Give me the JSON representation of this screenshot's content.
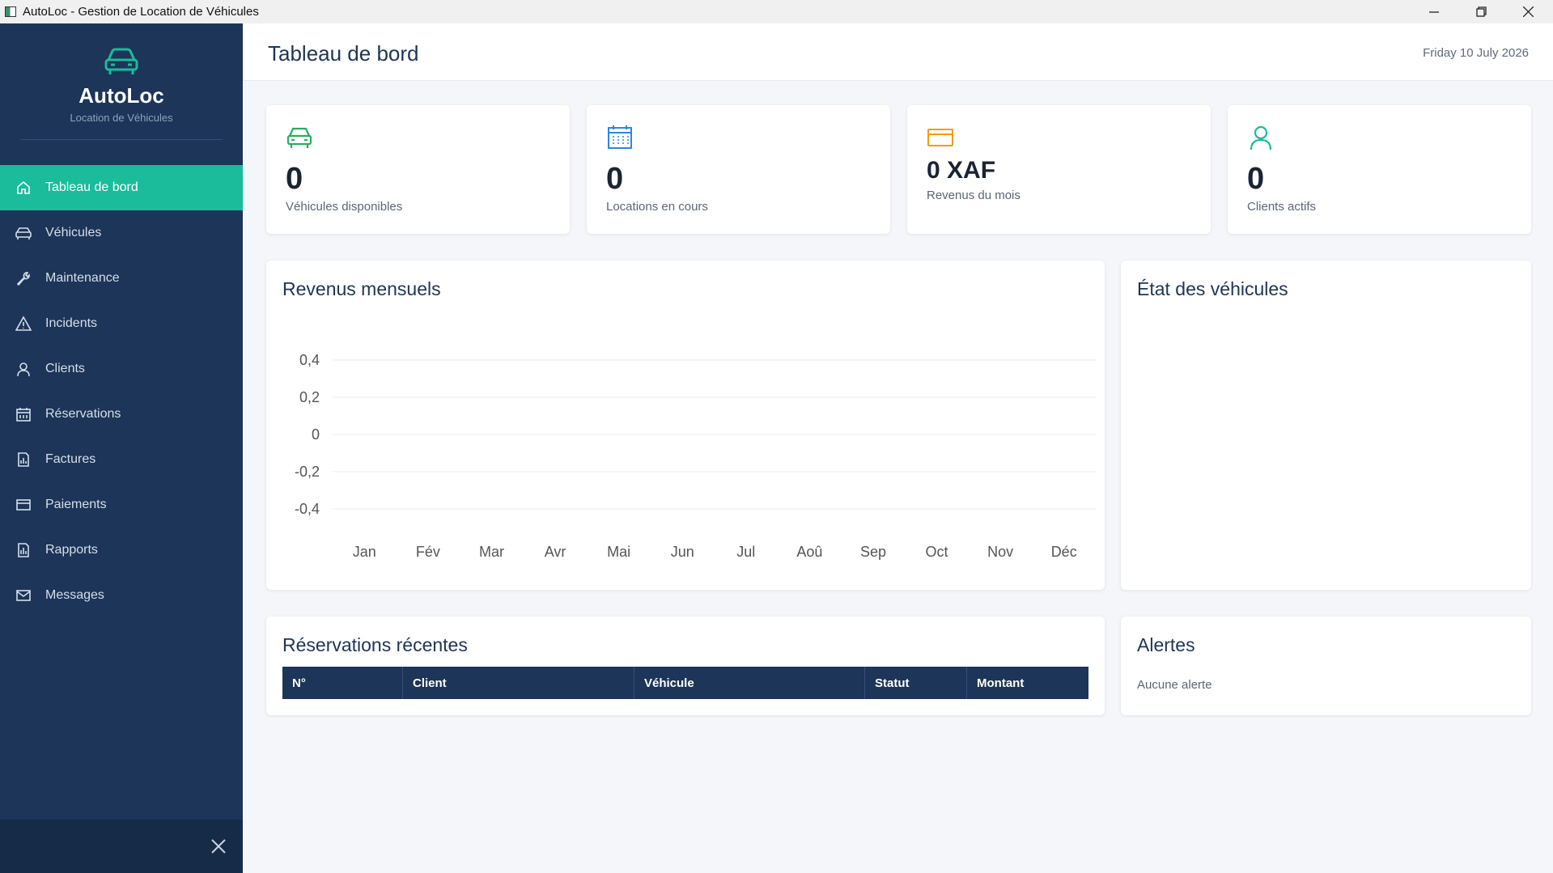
{
  "window": {
    "title": "AutoLoc - Gestion de Location de Véhicules"
  },
  "sidebar": {
    "brand_name": "AutoLoc",
    "brand_sub": "Location de Véhicules",
    "items": [
      {
        "label": "Tableau de bord",
        "icon": "home-icon",
        "active": true
      },
      {
        "label": "Véhicules",
        "icon": "car-icon",
        "active": false
      },
      {
        "label": "Maintenance",
        "icon": "wrench-icon",
        "active": false
      },
      {
        "label": "Incidents",
        "icon": "warning-icon",
        "active": false
      },
      {
        "label": "Clients",
        "icon": "user-icon",
        "active": false
      },
      {
        "label": "Réservations",
        "icon": "calendar-icon",
        "active": false
      },
      {
        "label": "Factures",
        "icon": "invoice-icon",
        "active": false
      },
      {
        "label": "Paiements",
        "icon": "card-icon",
        "active": false
      },
      {
        "label": "Rapports",
        "icon": "report-icon",
        "active": false
      },
      {
        "label": "Messages",
        "icon": "mail-icon",
        "active": false
      }
    ]
  },
  "header": {
    "title": "Tableau de bord",
    "date": "Friday 10 July 2026"
  },
  "stats": [
    {
      "value": "0",
      "label": "Véhicules disponibles",
      "icon": "car-icon",
      "color": "#27ae60"
    },
    {
      "value": "0",
      "label": "Locations en cours",
      "icon": "calendar-icon",
      "color": "#2e86de"
    },
    {
      "value": "0 XAF",
      "label": "Revenus du mois",
      "icon": "card-icon",
      "color": "#f39c12"
    },
    {
      "value": "0",
      "label": "Clients actifs",
      "icon": "user-icon",
      "color": "#1abc9c"
    }
  ],
  "revenue_panel": {
    "title": "Revenus mensuels"
  },
  "chart_data": {
    "type": "line",
    "categories": [
      "Jan",
      "Fév",
      "Mar",
      "Avr",
      "Mai",
      "Jun",
      "Jul",
      "Aoû",
      "Sep",
      "Oct",
      "Nov",
      "Déc"
    ],
    "series": [
      {
        "values": [
          0,
          0,
          0,
          0,
          0,
          0,
          0,
          0,
          0,
          0,
          0,
          0
        ]
      }
    ],
    "yticks": [
      "0,4",
      "0,2",
      "0",
      "-0,2",
      "-0,4"
    ],
    "ylim": [
      -0.4,
      0.4
    ],
    "grid": true,
    "legend": "none"
  },
  "vehicles_panel": {
    "title": "État des véhicules"
  },
  "reservations": {
    "title": "Réservations récentes",
    "columns": [
      "N°",
      "Client",
      "Véhicule",
      "Statut",
      "Montant"
    ],
    "rows": []
  },
  "alerts": {
    "title": "Alertes",
    "empty_text": "Aucune alerte"
  },
  "colors": {
    "sidebar": "#1c3558",
    "accent": "#1abc9c",
    "page_bg": "#f5f6f9"
  }
}
